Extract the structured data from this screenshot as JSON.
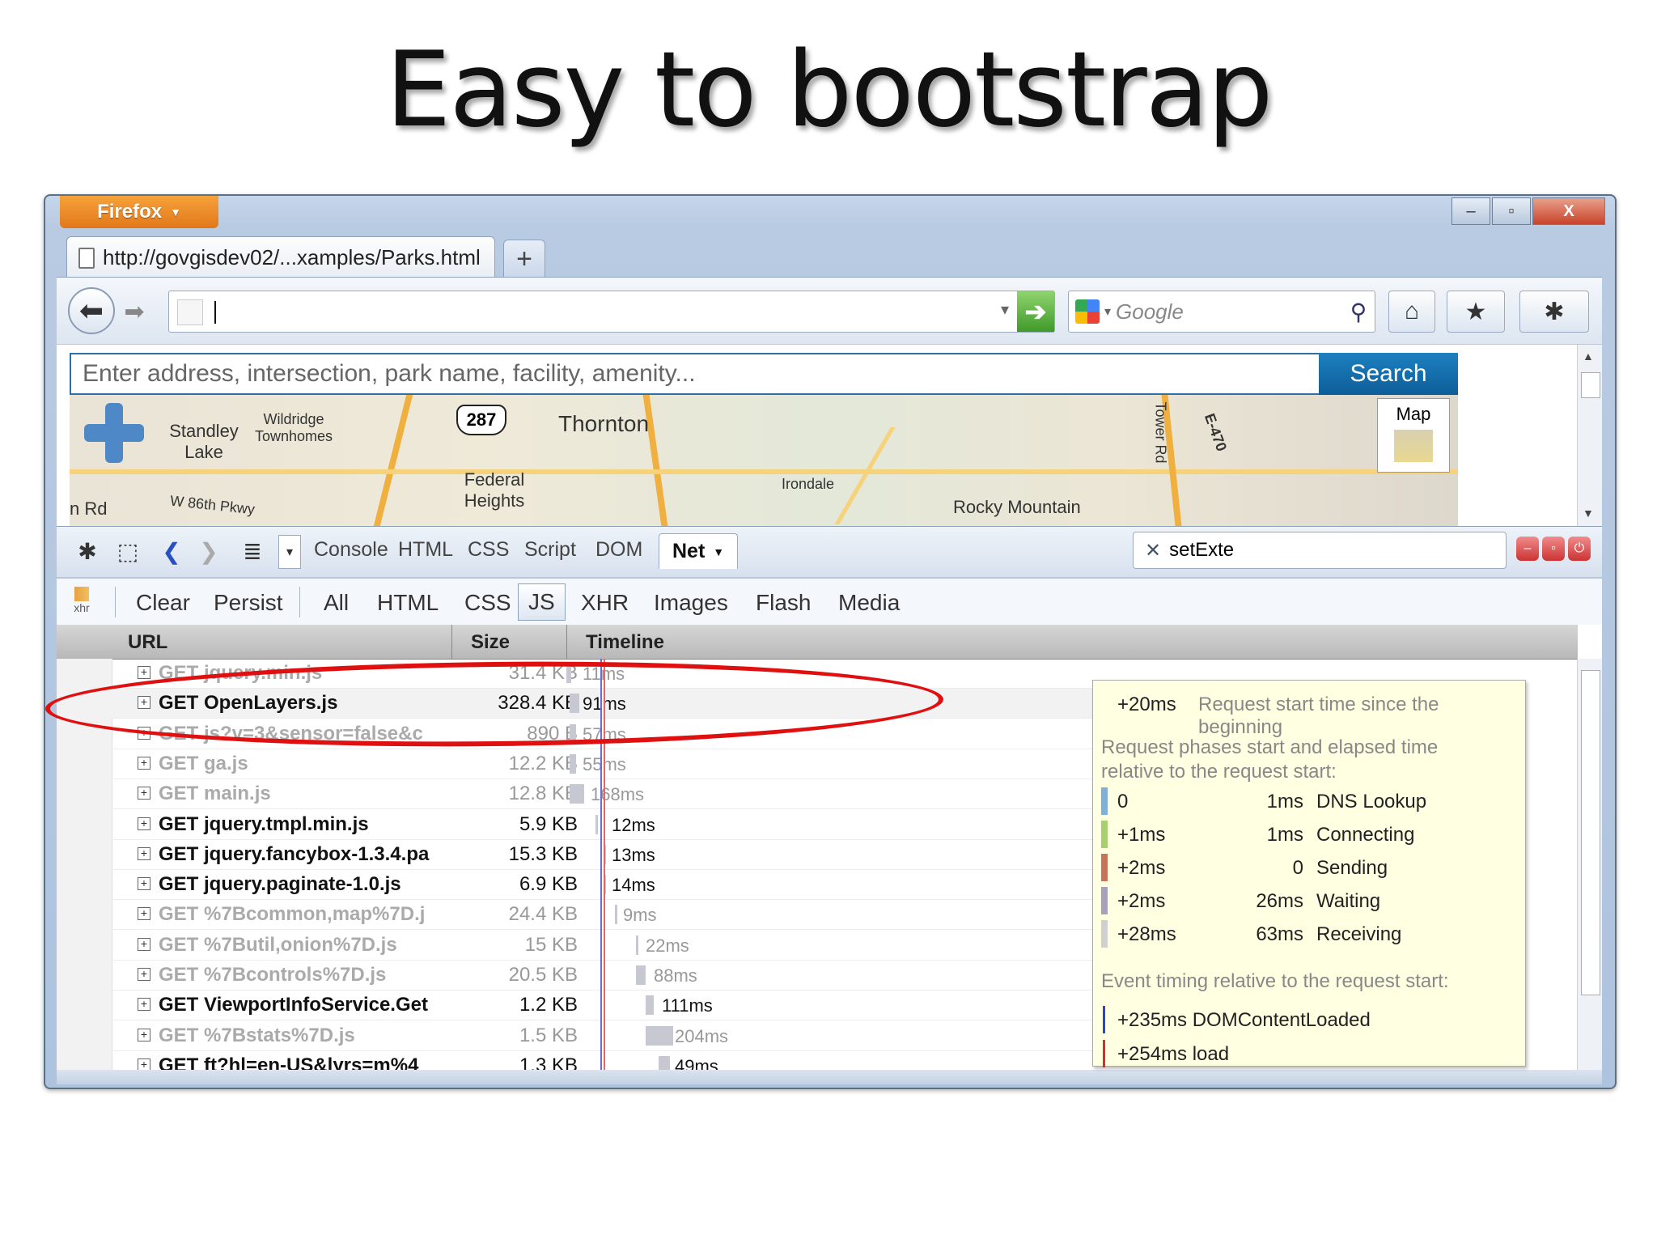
{
  "slide": {
    "title": "Easy to bootstrap"
  },
  "browser": {
    "menu_label": "Firefox",
    "tab_title": "http://govgisdev02/...xamples/Parks.html",
    "new_tab": "+",
    "search_placeholder": "Google",
    "window_buttons": [
      "–",
      "▫",
      "X"
    ]
  },
  "page": {
    "address_placeholder": "Enter address, intersection, park name, facility, amenity...",
    "search_button": "Search",
    "map_type_label": "Map",
    "map_labels": {
      "standley_lake": "Standley Lake",
      "wildridge": "Wildridge Townhomes",
      "w86": "W 86th Pkwy",
      "rd": "n Rd",
      "hwy": "287",
      "thornton": "Thornton",
      "federal_heights": "Federal Heights",
      "irondale": "Irondale",
      "rocky_mountain": "Rocky Mountain",
      "tower_rd": "Tower Rd",
      "e470": "E-470"
    }
  },
  "firebug": {
    "tabs": [
      "Console",
      "HTML",
      "CSS",
      "Script",
      "DOM"
    ],
    "active_tab": "Net",
    "search_value": "setExte",
    "filters": [
      "Clear",
      "Persist",
      "All",
      "HTML",
      "CSS",
      "JS",
      "XHR",
      "Images",
      "Flash",
      "Media"
    ],
    "active_filter": "JS",
    "xhr_icon_label": "xhr",
    "columns": {
      "url": "URL",
      "size": "Size",
      "timeline": "Timeline"
    },
    "requests": [
      {
        "url": "GET jquery.min.js",
        "size": "31.4 KB",
        "time": "11ms"
      },
      {
        "url": "GET OpenLayers.js",
        "size": "328.4 KB",
        "time": "91ms"
      },
      {
        "url": "GET js?v=3&sensor=false&c",
        "size": "890 B",
        "time": "57ms"
      },
      {
        "url": "GET ga.js",
        "size": "12.2 KB",
        "time": "55ms"
      },
      {
        "url": "GET main.js",
        "size": "12.8 KB",
        "time": "168ms"
      },
      {
        "url": "GET jquery.tmpl.min.js",
        "size": "5.9 KB",
        "time": "12ms"
      },
      {
        "url": "GET jquery.fancybox-1.3.4.pa",
        "size": "15.3 KB",
        "time": "13ms"
      },
      {
        "url": "GET jquery.paginate-1.0.js",
        "size": "6.9 KB",
        "time": "14ms"
      },
      {
        "url": "GET %7Bcommon,map%7D.j",
        "size": "24.4 KB",
        "time": "9ms"
      },
      {
        "url": "GET %7Butil,onion%7D.js",
        "size": "15 KB",
        "time": "22ms"
      },
      {
        "url": "GET %7Bcontrols%7D.js",
        "size": "20.5 KB",
        "time": "88ms"
      },
      {
        "url": "GET ViewportInfoService.Get",
        "size": "1.2 KB",
        "time": "111ms"
      },
      {
        "url": "GET %7Bstats%7D.js",
        "size": "1.5 KB",
        "time": "204ms"
      },
      {
        "url": "GET ft?hl=en-US&lyrs=m%4",
        "size": "1.3 KB",
        "time": "49ms"
      }
    ]
  },
  "tooltip": {
    "start": "+20ms",
    "start_desc": "Request start time since the beginning",
    "phases_heading": "Request phases start and elapsed time relative to the request start:",
    "phases": [
      {
        "start": "0",
        "elapsed": "1ms",
        "name": "DNS Lookup",
        "color": "#7fb0d8"
      },
      {
        "start": "+1ms",
        "elapsed": "1ms",
        "name": "Connecting",
        "color": "#a8d070"
      },
      {
        "start": "+2ms",
        "elapsed": "0",
        "name": "Sending",
        "color": "#c8735a"
      },
      {
        "start": "+2ms",
        "elapsed": "26ms",
        "name": "Waiting",
        "color": "#a8a0b8"
      },
      {
        "start": "+28ms",
        "elapsed": "63ms",
        "name": "Receiving",
        "color": "#d0d0d0"
      }
    ],
    "events_heading": "Event timing relative to the request start:",
    "events": [
      {
        "text": "+235ms DOMContentLoaded",
        "color": "#3040d0"
      },
      {
        "text": "+254ms load",
        "color": "#d03030"
      }
    ]
  }
}
